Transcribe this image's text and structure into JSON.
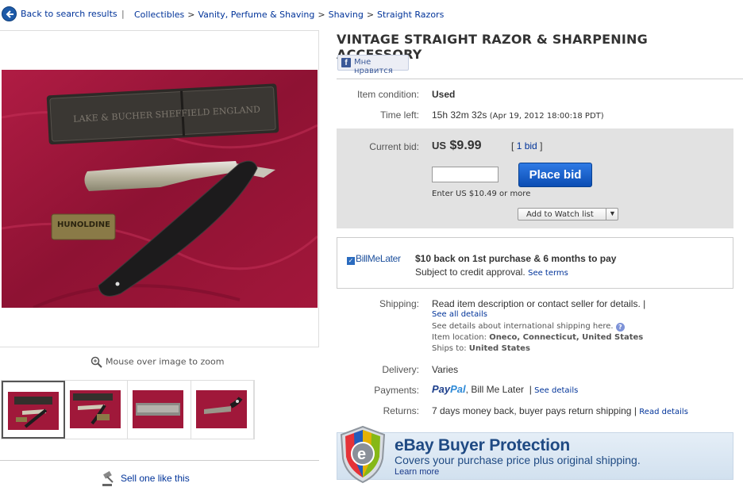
{
  "nav": {
    "back_label": "Back to search results",
    "separator": "|",
    "breadcrumbs": [
      "Collectibles",
      "Vanity, Perfume & Shaving",
      "Shaving",
      "Straight Razors"
    ]
  },
  "gallery": {
    "zoom_hint": "Mouse over image to zoom",
    "sell_one": "Sell one like this",
    "box_text": "LAKE & BUCHER SHEFFIELD ENGLAND",
    "hone_text": "HUNOLDINE"
  },
  "listing": {
    "title": "VINTAGE STRAIGHT RAZOR & SHARPENING ACCESSORY",
    "like_label": "Мне нравится",
    "condition_label": "Item condition:",
    "condition_value": "Used",
    "time_left_label": "Time left:",
    "time_left_value": "15h 32m 32s",
    "end_date": "(Apr 19, 2012 18:00:18 PDT)"
  },
  "bidding": {
    "current_bid_label": "Current bid:",
    "currency": "US",
    "amount": "$9.99",
    "bids_open": "[",
    "bids_link": "1 bid",
    "bids_close": "]",
    "bid_input_value": "",
    "place_bid_label": "Place bid",
    "min_bid": "Enter US $10.49 or more",
    "watch_label": "Add to Watch list"
  },
  "billmelater": {
    "logo": "BillMeLater",
    "headline": "$10 back on 1st purchase & 6 months to pay",
    "sub": "Subject to credit approval.",
    "terms_link": "See terms"
  },
  "shipping": {
    "label": "Shipping:",
    "text": "Read item description or contact seller for details.",
    "pipe": "|",
    "see_all": "See all details",
    "intl": "See details about international shipping here.",
    "location_label": "Item location:",
    "location": "Oneco, Connecticut, United States",
    "ships_to_label": "Ships to:",
    "ships_to": "United States"
  },
  "delivery": {
    "label": "Delivery:",
    "value": "Varies"
  },
  "payments": {
    "label": "Payments:",
    "paypal_a": "Pay",
    "paypal_b": "Pal",
    "methods": ", Bill Me Later",
    "pipe": "|",
    "link": "See details"
  },
  "returns": {
    "label": "Returns:",
    "value": "7 days money back, buyer pays return shipping",
    "pipe": "|",
    "link": "Read details"
  },
  "protection": {
    "title": "eBay Buyer Protection",
    "subtitle": "Covers your purchase price plus original shipping.",
    "learn": "Learn more",
    "shield_letter": "e"
  },
  "colors": {
    "link": "#003399",
    "button": "#1a5fc9",
    "photo_bg": "#a0183a"
  }
}
